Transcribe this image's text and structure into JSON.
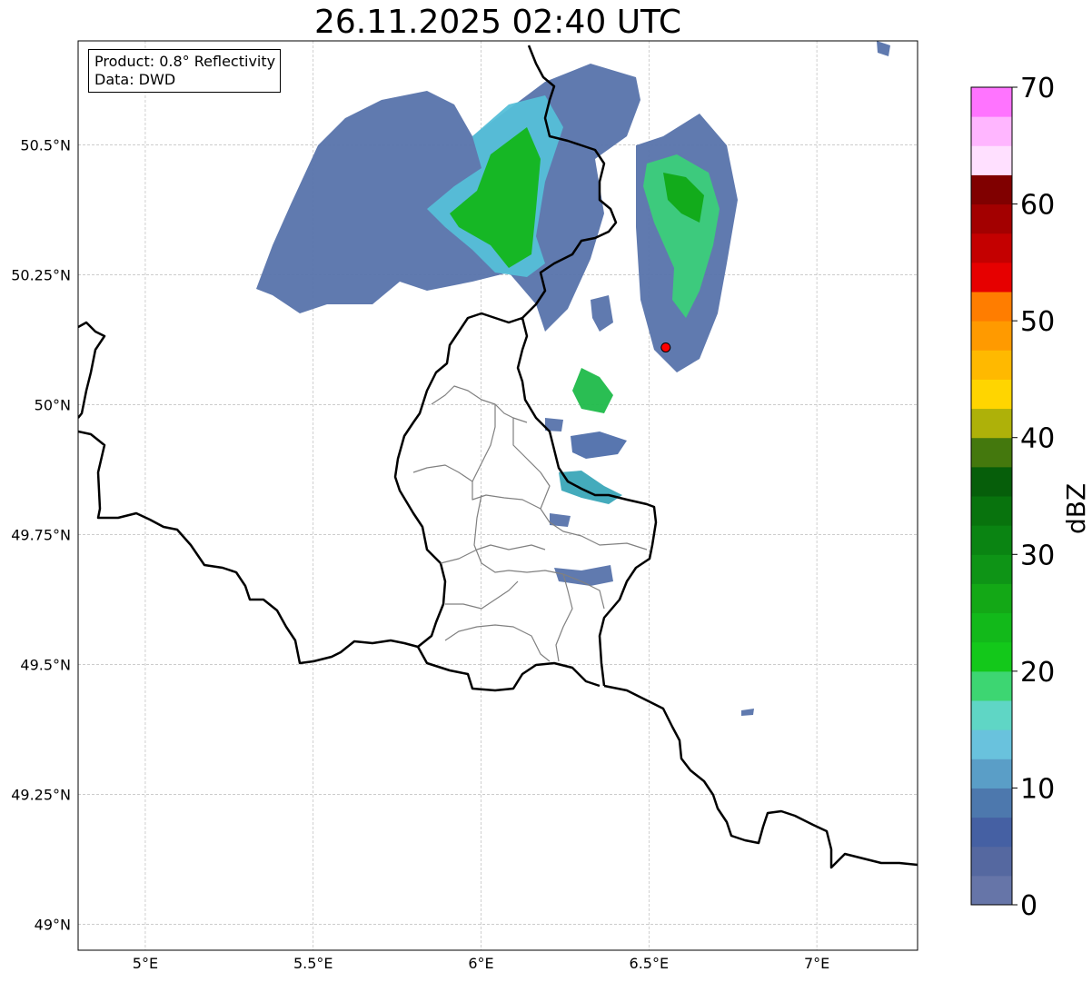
{
  "title": "26.11.2025 02:40 UTC",
  "info": {
    "product": "Product: 0.8° Reflectivity",
    "source": "Data: DWD"
  },
  "map": {
    "lon_range": [
      4.8,
      7.3
    ],
    "lat_range": [
      48.95,
      50.7
    ],
    "x_ticks": [
      {
        "value": 5.0,
        "label": "5°E"
      },
      {
        "value": 5.5,
        "label": "5.5°E"
      },
      {
        "value": 6.0,
        "label": "6°E"
      },
      {
        "value": 6.5,
        "label": "6.5°E"
      },
      {
        "value": 7.0,
        "label": "7°E"
      }
    ],
    "y_ticks": [
      {
        "value": 49.0,
        "label": "49°N"
      },
      {
        "value": 49.25,
        "label": "49.25°N"
      },
      {
        "value": 49.5,
        "label": "49.5°N"
      },
      {
        "value": 49.75,
        "label": "49.75°N"
      },
      {
        "value": 50.0,
        "label": "50°N"
      },
      {
        "value": 50.25,
        "label": "50.25°N"
      },
      {
        "value": 50.5,
        "label": "50.5°N"
      }
    ],
    "radar_site": {
      "lon": 6.55,
      "lat": 50.11,
      "color": "#ff0000"
    },
    "border_color": "#000000",
    "district_color": "#808080"
  },
  "colorbar": {
    "unit": "dBZ",
    "min": 0,
    "max": 70,
    "step": 2.5,
    "tick_labels": [
      "0",
      "10",
      "20",
      "30",
      "40",
      "50",
      "60",
      "70"
    ],
    "tick_values": [
      0,
      10,
      20,
      30,
      40,
      50,
      60,
      70
    ],
    "colors": [
      "#6675a8",
      "#5568a0",
      "#4560a3",
      "#4d78ad",
      "#5a9ec7",
      "#69c2dd",
      "#5fd6c5",
      "#3dd672",
      "#13c81a",
      "#12b91a",
      "#13a816",
      "#0e9416",
      "#0a8412",
      "#08730d",
      "#065e0a",
      "#44780d",
      "#aeb109",
      "#ffd500",
      "#ffb900",
      "#ff9a00",
      "#ff7d00",
      "#e60000",
      "#c40000",
      "#a30000",
      "#800000",
      "#ffe0ff",
      "#ffb6ff",
      "#ff74ff",
      "#ef3cf0"
    ]
  }
}
